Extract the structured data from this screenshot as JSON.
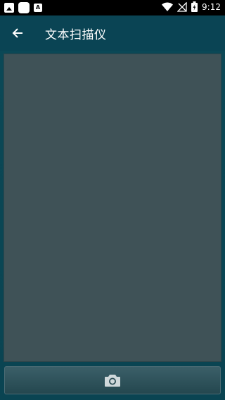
{
  "status_bar": {
    "time": "9:12",
    "left_icons": [
      "image-icon",
      "square-icon",
      "a-icon"
    ],
    "right_icons": [
      "wifi-icon",
      "no-signal-icon",
      "battery-icon"
    ]
  },
  "app_bar": {
    "title": "文本扫描仪",
    "back_icon": "back-arrow-icon"
  },
  "main": {
    "capture_icon": "camera-icon"
  },
  "colors": {
    "app_bar_bg": "#0a4454",
    "preview_bg": "#3f5257",
    "status_bar_bg": "#000000"
  }
}
